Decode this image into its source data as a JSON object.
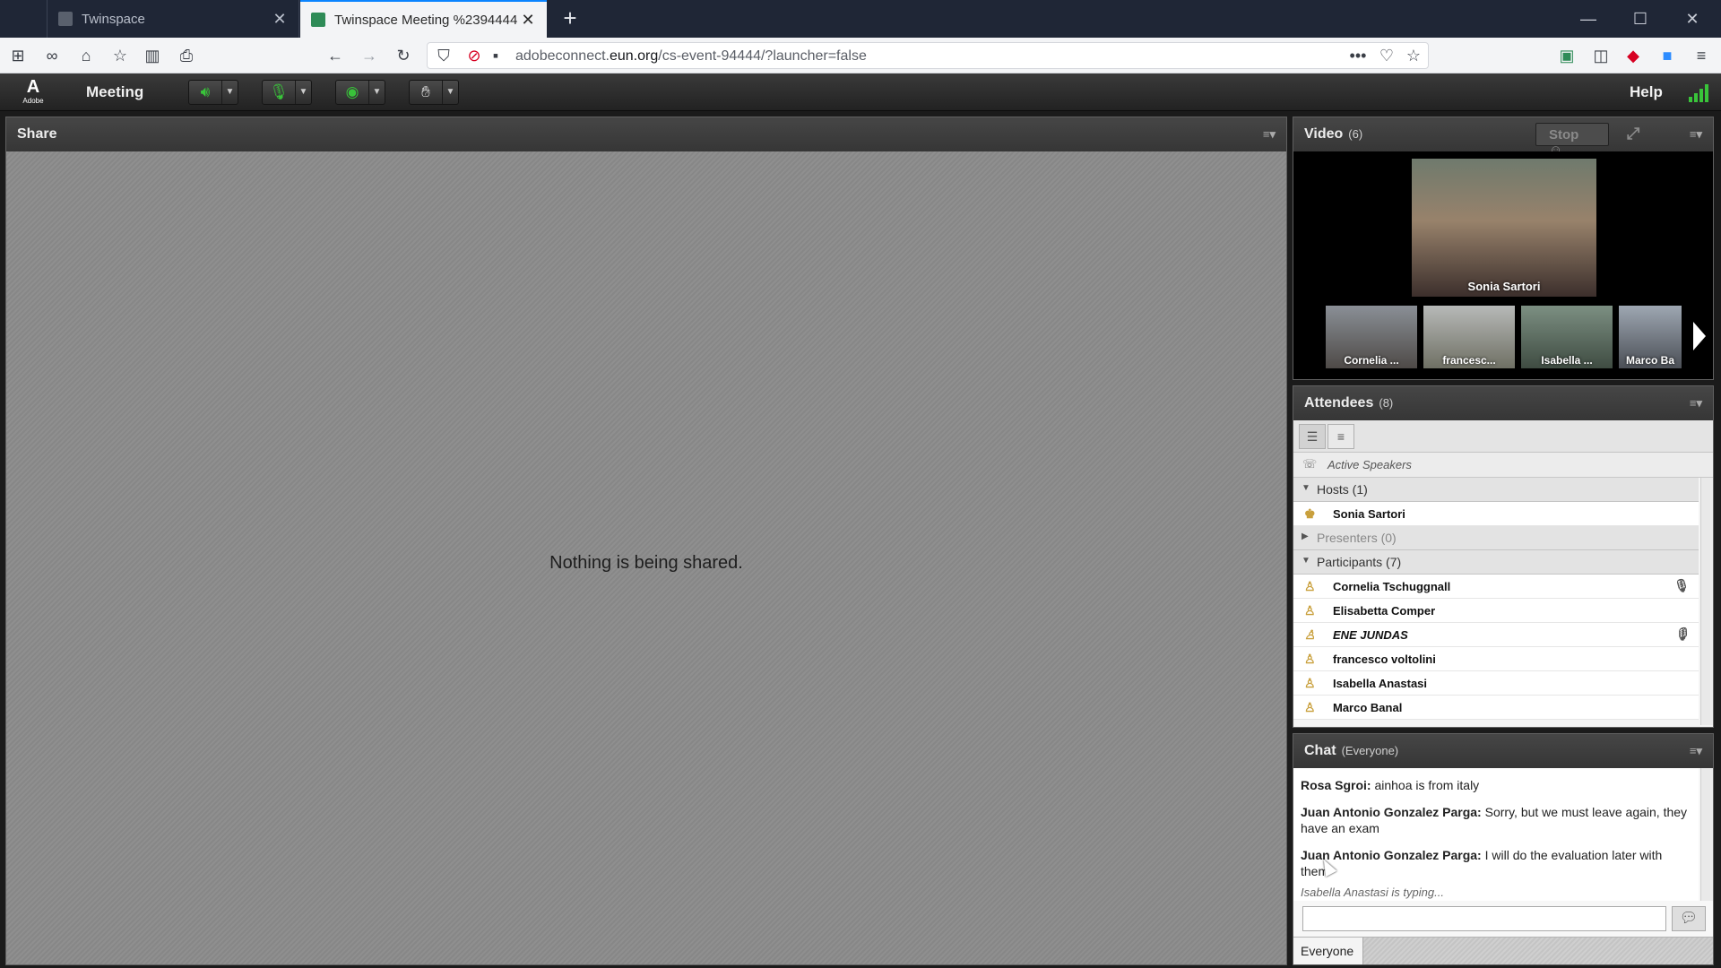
{
  "browser": {
    "tabs": [
      {
        "title": "Twinspace",
        "active": false
      },
      {
        "title": "Twinspace Meeting %2394444",
        "active": true
      }
    ],
    "url_host_prefix": "adobeconnect.",
    "url_domain": "eun.org",
    "url_path": "/cs-event-94444/?launcher=false"
  },
  "app": {
    "logo_text": "Adobe",
    "menu_meeting": "Meeting",
    "menu_help": "Help"
  },
  "share": {
    "title": "Share",
    "empty_message": "Nothing is being shared."
  },
  "video": {
    "title": "Video",
    "count": "(6)",
    "stop_label": "Stop",
    "main_name": "Sonia Sartori",
    "thumbs": [
      "Cornelia ...",
      "francesc...",
      "Isabella ...",
      "Marco Ba"
    ]
  },
  "attendees": {
    "title": "Attendees",
    "count": "(8)",
    "active_speakers": "Active Speakers",
    "hosts_label": "Hosts (1)",
    "hosts": [
      "Sonia Sartori"
    ],
    "presenters_label": "Presenters (0)",
    "participants_label": "Participants (7)",
    "participants": [
      {
        "name": "Cornelia Tschuggnall",
        "mic": true
      },
      {
        "name": "Elisabetta Comper",
        "mic": false
      },
      {
        "name": "ENE JUNDAS",
        "mic": true
      },
      {
        "name": "francesco voltolini",
        "mic": false
      },
      {
        "name": "Isabella Anastasi",
        "mic": false
      },
      {
        "name": "Marco Banal",
        "mic": false
      }
    ]
  },
  "chat": {
    "title": "Chat",
    "scope": "(Everyone)",
    "messages": [
      {
        "sender": "Rosa Sgroi:",
        "text": " ainhoa is from italy"
      },
      {
        "sender": "Juan Antonio Gonzalez Parga:",
        "text": " Sorry, but we must leave again, they have an exam"
      },
      {
        "sender": "Juan Antonio Gonzalez Parga:",
        "text": " I will do the evaluation later with them"
      }
    ],
    "typing": "Isabella Anastasi is typing...",
    "tab_everyone": "Everyone"
  },
  "colors": {
    "accent_tab": "#0a84ff",
    "active_green": "#39c43a",
    "host_icon": "#c9a03d"
  }
}
